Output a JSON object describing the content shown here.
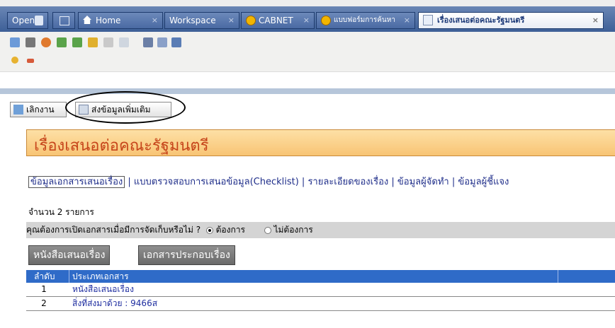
{
  "tabs": [
    {
      "label": "Open",
      "icon": "download-icon"
    },
    {
      "label": "Home",
      "icon": "home-icon"
    },
    {
      "label": "Workspace",
      "icon": ""
    },
    {
      "label": "CABNET",
      "icon": "cabnet-icon"
    },
    {
      "label": "แบบฟอร์มการค้นหา",
      "icon": "cabnet-icon"
    },
    {
      "label": "เรื่องเสนอต่อคณะรัฐมนตรี",
      "icon": "document-icon"
    }
  ],
  "tab_close": "×",
  "actions": {
    "cancel_label": "เลิกงาน",
    "send_more_label": "ส่งข้อมูลเพิ่มเติม"
  },
  "page": {
    "title": "เรื่องเสนอต่อคณะรัฐมนตรี",
    "subtabs": [
      "ข้อมูลเอกสารเสนอเรื่อง",
      "แบบตรวจสอบการเสนอข้อมูล(Checklist)",
      "รายละเอียดของเรื่อง",
      "ข้อมูลผู้จัดทำ",
      "ข้อมูลผู้ชี้แจง"
    ],
    "count_text": "จำนวน 2 รายการ",
    "question": "คุณต้องการเปิดเอกสารเมื่อมีการจัดเก็บหรือไม่ ?",
    "option_yes": "ต้องการ",
    "option_no": "ไม่ต้องการ",
    "selected_option": "ต้องการ",
    "doc_buttons": [
      "หนังสือเสนอเรื่อง",
      "เอกสารประกอบเรื่อง"
    ],
    "table": {
      "headers": [
        "ลำดับ",
        "ประเภทเอกสาร"
      ],
      "rows": [
        {
          "no": "1",
          "type": "หนังสือเสนอเรื่อง"
        },
        {
          "no": "2",
          "type": "สิ่งที่ส่งมาด้วย : 9466ส"
        }
      ]
    }
  },
  "colors": {
    "tabbar": "#4a6aa3",
    "title_bg": "#f8c474",
    "title_text": "#c6451b",
    "table_header": "#2f6bc8",
    "link": "#1f2ea0"
  }
}
